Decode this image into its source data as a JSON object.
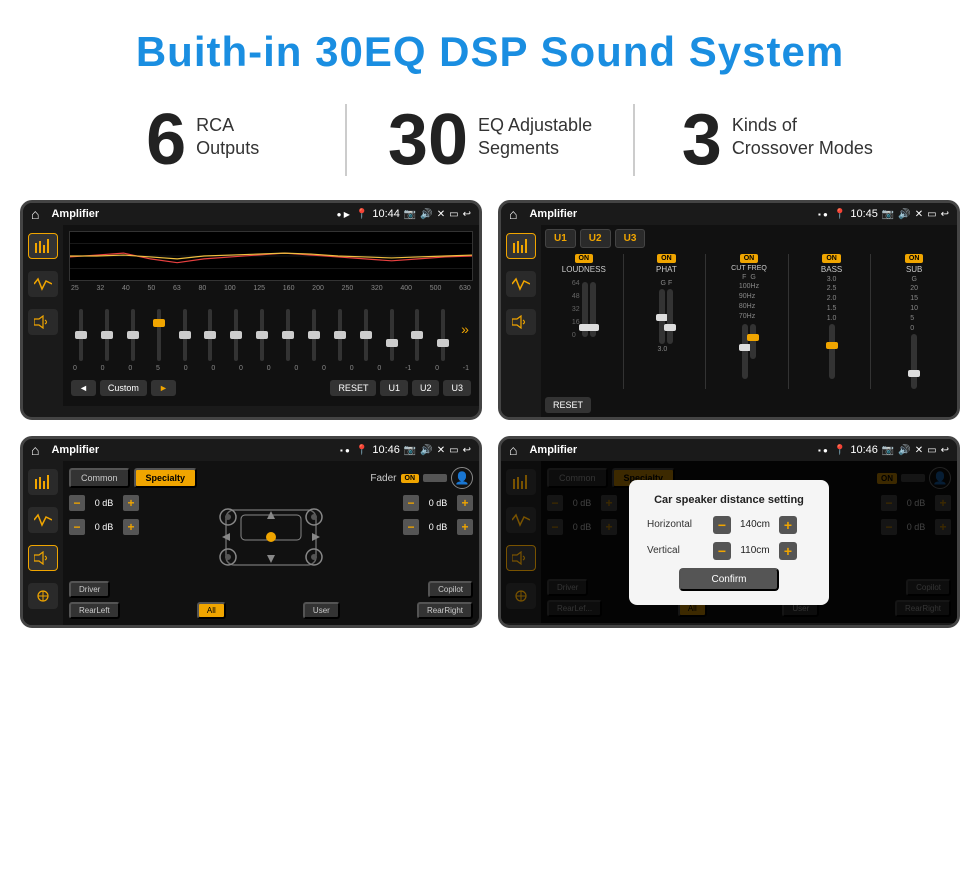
{
  "header": {
    "title": "Buith-in 30EQ DSP Sound System"
  },
  "stats": [
    {
      "number": "6",
      "line1": "RCA",
      "line2": "Outputs"
    },
    {
      "number": "30",
      "line1": "EQ Adjustable",
      "line2": "Segments"
    },
    {
      "number": "3",
      "line1": "Kinds of",
      "line2": "Crossover Modes"
    }
  ],
  "screens": {
    "screen1": {
      "app": "Amplifier",
      "time": "10:44",
      "eq_freqs": [
        "25",
        "32",
        "40",
        "50",
        "63",
        "80",
        "100",
        "125",
        "160",
        "200",
        "250",
        "320",
        "400",
        "500",
        "630"
      ],
      "eq_values": [
        "0",
        "0",
        "0",
        "5",
        "0",
        "0",
        "0",
        "0",
        "0",
        "0",
        "0",
        "0",
        "-1",
        "0",
        "-1"
      ],
      "controls": [
        "◄",
        "Custom",
        "►",
        "RESET",
        "U1",
        "U2",
        "U3"
      ]
    },
    "screen2": {
      "app": "Amplifier",
      "time": "10:45",
      "channels": [
        "U1",
        "U2",
        "U3"
      ],
      "modules": [
        {
          "label": "LOUDNESS",
          "on": true
        },
        {
          "label": "PHAT",
          "on": true
        },
        {
          "label": "CUT FREQ",
          "on": true
        },
        {
          "label": "BASS",
          "on": true
        },
        {
          "label": "SUB",
          "on": true
        }
      ],
      "reset_label": "RESET"
    },
    "screen3": {
      "app": "Amplifier",
      "time": "10:46",
      "tabs": [
        "Common",
        "Specialty"
      ],
      "active_tab": "Specialty",
      "fader_label": "Fader",
      "fader_on": true,
      "db_values": [
        "0 dB",
        "0 dB",
        "0 dB",
        "0 dB"
      ],
      "bottom_btns": [
        "Driver",
        "",
        "Copilot",
        "RearLeft",
        "All",
        "User",
        "RearRight"
      ]
    },
    "screen4": {
      "app": "Amplifier",
      "time": "10:46",
      "dialog": {
        "title": "Car speaker distance setting",
        "horizontal_label": "Horizontal",
        "horizontal_value": "140cm",
        "vertical_label": "Vertical",
        "vertical_value": "110cm",
        "confirm_label": "Confirm"
      }
    }
  }
}
